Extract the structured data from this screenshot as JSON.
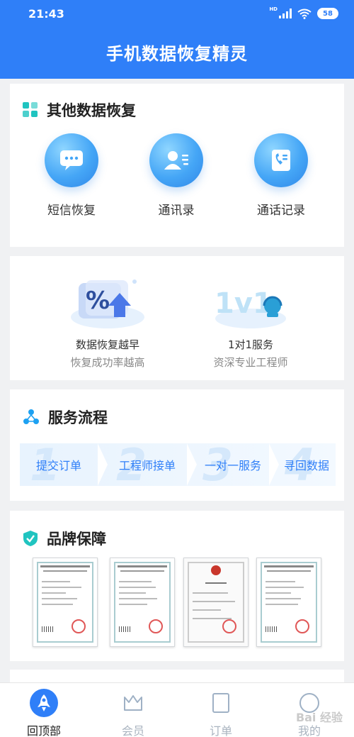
{
  "status_bar": {
    "time": "21:43",
    "network": "HD",
    "battery": "58"
  },
  "header": {
    "title": "手机数据恢复精灵"
  },
  "other_recovery": {
    "title": "其他数据恢复",
    "items": [
      {
        "label": "短信恢复",
        "icon": "message-icon"
      },
      {
        "label": "通讯录",
        "icon": "contacts-icon"
      },
      {
        "label": "通话记录",
        "icon": "call-log-icon"
      }
    ]
  },
  "promos": [
    {
      "line1": "数据恢复越早",
      "line2": "恢复成功率越高",
      "art_text": "%"
    },
    {
      "line1": "1对1服务",
      "line2": "资深专业工程师",
      "art_text": "1v1"
    }
  ],
  "service_flow": {
    "title": "服务流程",
    "steps": [
      {
        "num": "1",
        "label": "提交订单"
      },
      {
        "num": "2",
        "label": "工程师接单"
      },
      {
        "num": "3",
        "label": "一对一服务"
      },
      {
        "num": "4",
        "label": "寻回数据"
      }
    ]
  },
  "brand": {
    "title": "品牌保障",
    "certificates": 4
  },
  "bottom_nav": {
    "items": [
      {
        "label": "回顶部",
        "icon": "rocket-icon",
        "active": true
      },
      {
        "label": "会员",
        "icon": "crown-icon",
        "active": false
      },
      {
        "label": "订单",
        "icon": "order-icon",
        "active": false
      },
      {
        "label": "我的",
        "icon": "profile-icon",
        "active": false
      }
    ]
  },
  "watermark": "Bai 经验",
  "colors": {
    "primary": "#2f7ff8",
    "accent_teal": "#20c4c0",
    "page_bg": "#f0f1f3"
  }
}
